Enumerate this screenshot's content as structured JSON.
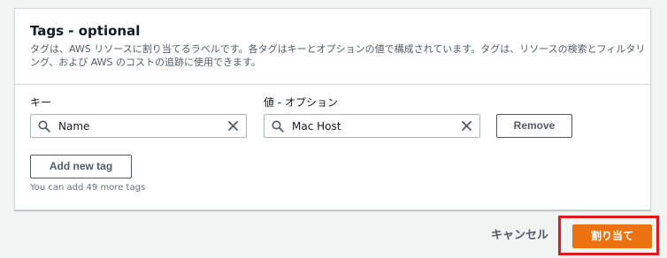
{
  "panel": {
    "title": "Tags - optional",
    "description": "タグは、AWS リソースに割り当てるラベルです。各タグはキーとオプションの値で構成されています。タグは、リソースの検索とフィルタリング、および AWS のコストの追跡に使用できます。"
  },
  "tag_row": {
    "key_label": "キー",
    "value_label": "値 - オプション",
    "key_value": "Name",
    "value_value": "Mac Host",
    "remove_label": "Remove"
  },
  "add_tag": {
    "label": "Add new tag",
    "hint": "You can add 49 more tags"
  },
  "footer": {
    "cancel_label": "キャンセル",
    "assign_label": "割り当て",
    "highlight_color": "#e0191e",
    "primary_color": "#ec7211"
  },
  "icons": {
    "search": "search-icon",
    "clear": "close-icon"
  }
}
